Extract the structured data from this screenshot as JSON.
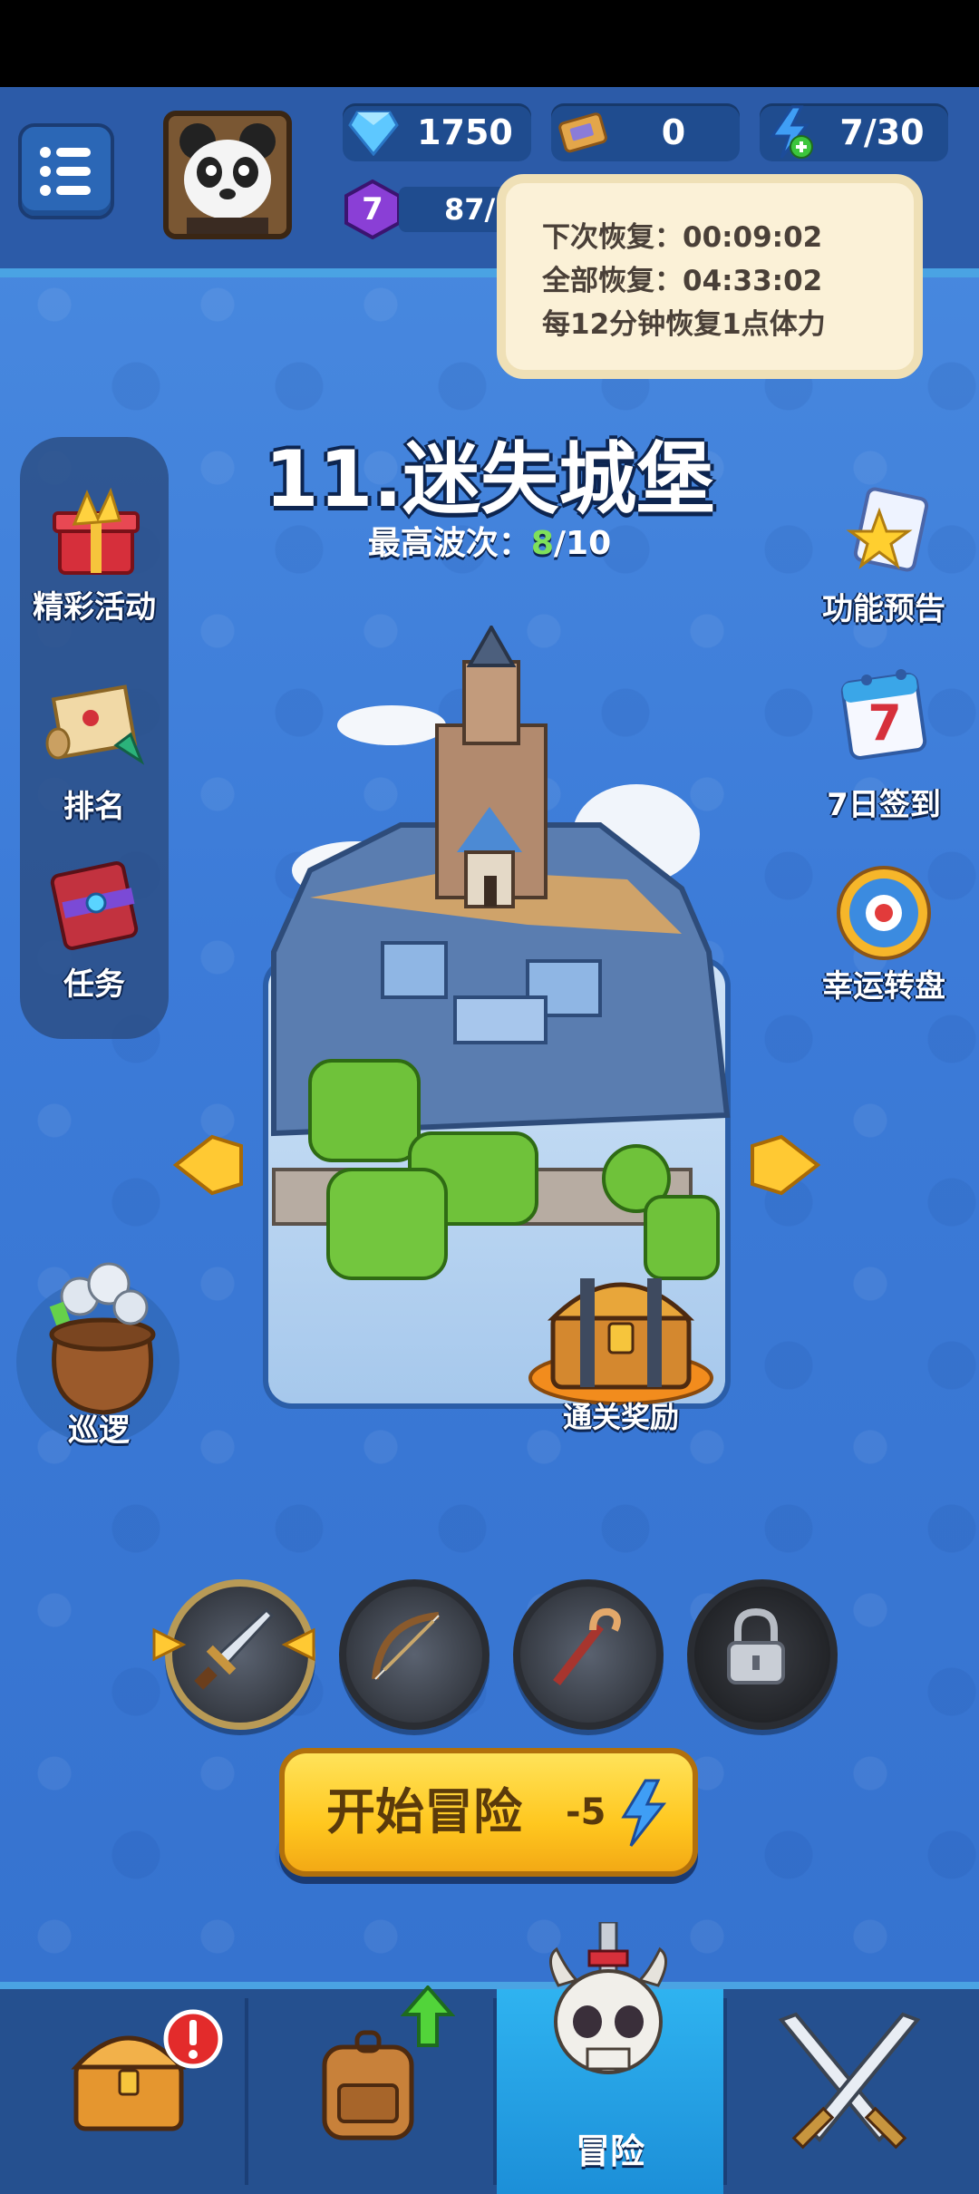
{
  "top": {
    "gems": "1750",
    "tickets": "0",
    "energy": "7/30",
    "player_level": "7",
    "xp_text": "87/"
  },
  "tooltip": {
    "line1": "下次恢复：00:09:02",
    "line2": "全部恢复：04:33:02",
    "line3": "每12分钟恢复1点体力"
  },
  "stage": {
    "title": "11.迷失城堡",
    "best_wave_label": "最高波次：",
    "best_wave_current": "8",
    "best_wave_total": "/10"
  },
  "left_menu": {
    "events": "精彩活动",
    "ranking": "排名",
    "tasks": "任务",
    "patrol": "巡逻"
  },
  "right_menu": {
    "preview": "功能预告",
    "checkin": "7日签到",
    "wheel": "幸运转盘",
    "checkin_day": "7"
  },
  "reward": {
    "label": "通关奖励"
  },
  "start": {
    "label": "开始冒险",
    "cost": "-5"
  },
  "nav": {
    "adventure": "冒险"
  },
  "colors": {
    "accent": "#4aa3e3",
    "button": "#ffc71f",
    "wave_current": "#7ee05a"
  }
}
